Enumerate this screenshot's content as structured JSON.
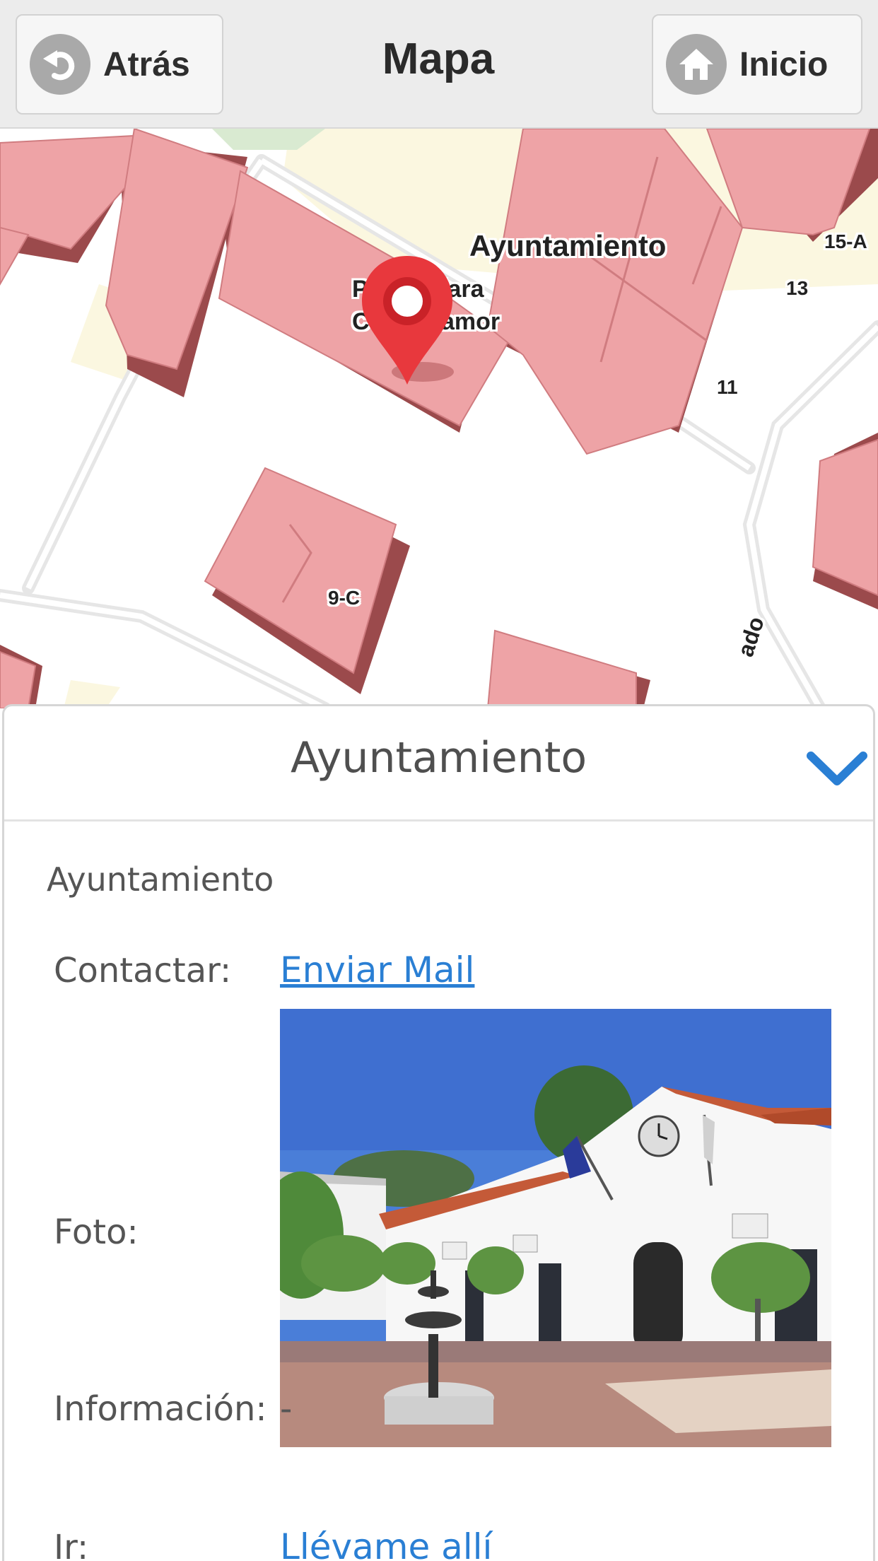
{
  "header": {
    "title": "Mapa",
    "back_label": "Atrás",
    "home_label": "Inicio"
  },
  "map": {
    "place_label": "Ayuntamiento",
    "poi_label_line1": "P",
    "poi_label_line1b": "lara",
    "poi_label_line2": "C",
    "poi_label_line2b": "amor",
    "house_numbers": [
      "15-A",
      "13",
      "11",
      "9-C"
    ],
    "street_fragment": "ado",
    "marker_color": "#e8383d",
    "building_color": "#eea3a6"
  },
  "panel": {
    "title": "Ayuntamiento",
    "subtitle": "Ayuntamiento",
    "contact_label": "Contactar:",
    "contact_link": "Enviar Mail",
    "photo_label": "Foto:",
    "info_label": "Información:",
    "info_value": "-",
    "go_label": "Ir:",
    "go_link": "Llévame allí",
    "accent": "#2a7fd4"
  }
}
